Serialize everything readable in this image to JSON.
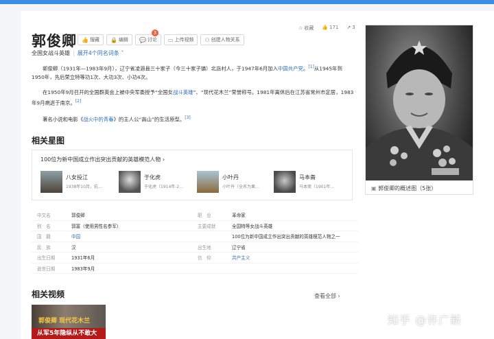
{
  "title": "郭俊卿",
  "toolbar": {
    "collect": "搜藏",
    "edit": "编辑",
    "discuss": "讨论",
    "discuss_badge": "3",
    "upload_video": "上传视频",
    "create_relation": "创建人物关系"
  },
  "stats": {
    "favorite": "收藏",
    "like_count": "171",
    "share_count": "3"
  },
  "subtitle": {
    "text": "全国女战斗英雄",
    "sep": "|",
    "expand": "展开4个同名词条"
  },
  "summary": {
    "p1_a": "郭俊卿（1931年—1983年9月），辽宁省凌源县三十家子（今三十家子镇）北店村人，于1947年6月加入",
    "p1_link": "中国共产党",
    "p1_b": "。",
    "p1_ref": "[1]",
    "p1_c": "从1945年到1950年，先后荣立特等功1次、大功3次、小功4次。",
    "p2_a": "在1950年9月召开的全国群英会上被中央军委授予“全国女",
    "p2_link": "战斗英雄",
    "p2_b": "”、“现代花木兰”荣誉称号。1981年离休后在江苏省常州市定居，1983年9月病逝于南京。",
    "p2_ref": "[2]",
    "p3_a": "著名小说和电影《",
    "p3_link": "战火中的青春",
    "p3_b": "》的主人公“高山”的生活原型。",
    "p3_ref": "[3]"
  },
  "photo": {
    "caption": "郭俊卿的概述图（5张）"
  },
  "stars": {
    "heading": "相关星图",
    "title": "100位为新中国成立作出突出贡献的英雄模范人物",
    "items": [
      {
        "name": "八女投江",
        "desc": "1938年10月，抗..."
      },
      {
        "name": "于化虎",
        "desc": "于化虎（1914年-2..."
      },
      {
        "name": "小叶丹",
        "desc": "小叶丹（全名为果..."
      },
      {
        "name": "马本斋",
        "desc": "马本斋（1901年..."
      }
    ]
  },
  "info": {
    "rows": [
      {
        "k1": "中文名",
        "v1": "郭俊卿",
        "k2": "职　业",
        "v2": "革命家"
      },
      {
        "k1": "别　名",
        "v1": "郭富（使用男性名参军）",
        "k2": "主要成就",
        "v2": "全国特等女战斗英雄"
      },
      {
        "k1": "国　籍",
        "v1": "中国",
        "k2": "",
        "v2": "100位为新中国成立作出突出贡献的英雄模范人物之一"
      },
      {
        "k1": "民　族",
        "v1": "汉",
        "k2": "出生地",
        "v2": "辽宁省"
      },
      {
        "k1": "出生日期",
        "v1": "1931年6月",
        "k2": "信　仰",
        "v2": "共产主义"
      },
      {
        "k1": "逝世日期",
        "v1": "1983年9月",
        "k2": "",
        "v2": ""
      }
    ]
  },
  "videos": {
    "heading": "相关视频",
    "all": "查看全部",
    "thumb_title": "郭俊卿 现代花木兰",
    "thumb_banner": "从军5年隐纵从不敢大"
  },
  "watermark": "知乎 @许广新",
  "colors": {
    "link": "#2e6ec2",
    "topbar": "#3a8ee6",
    "badge": "#f25e3d"
  }
}
